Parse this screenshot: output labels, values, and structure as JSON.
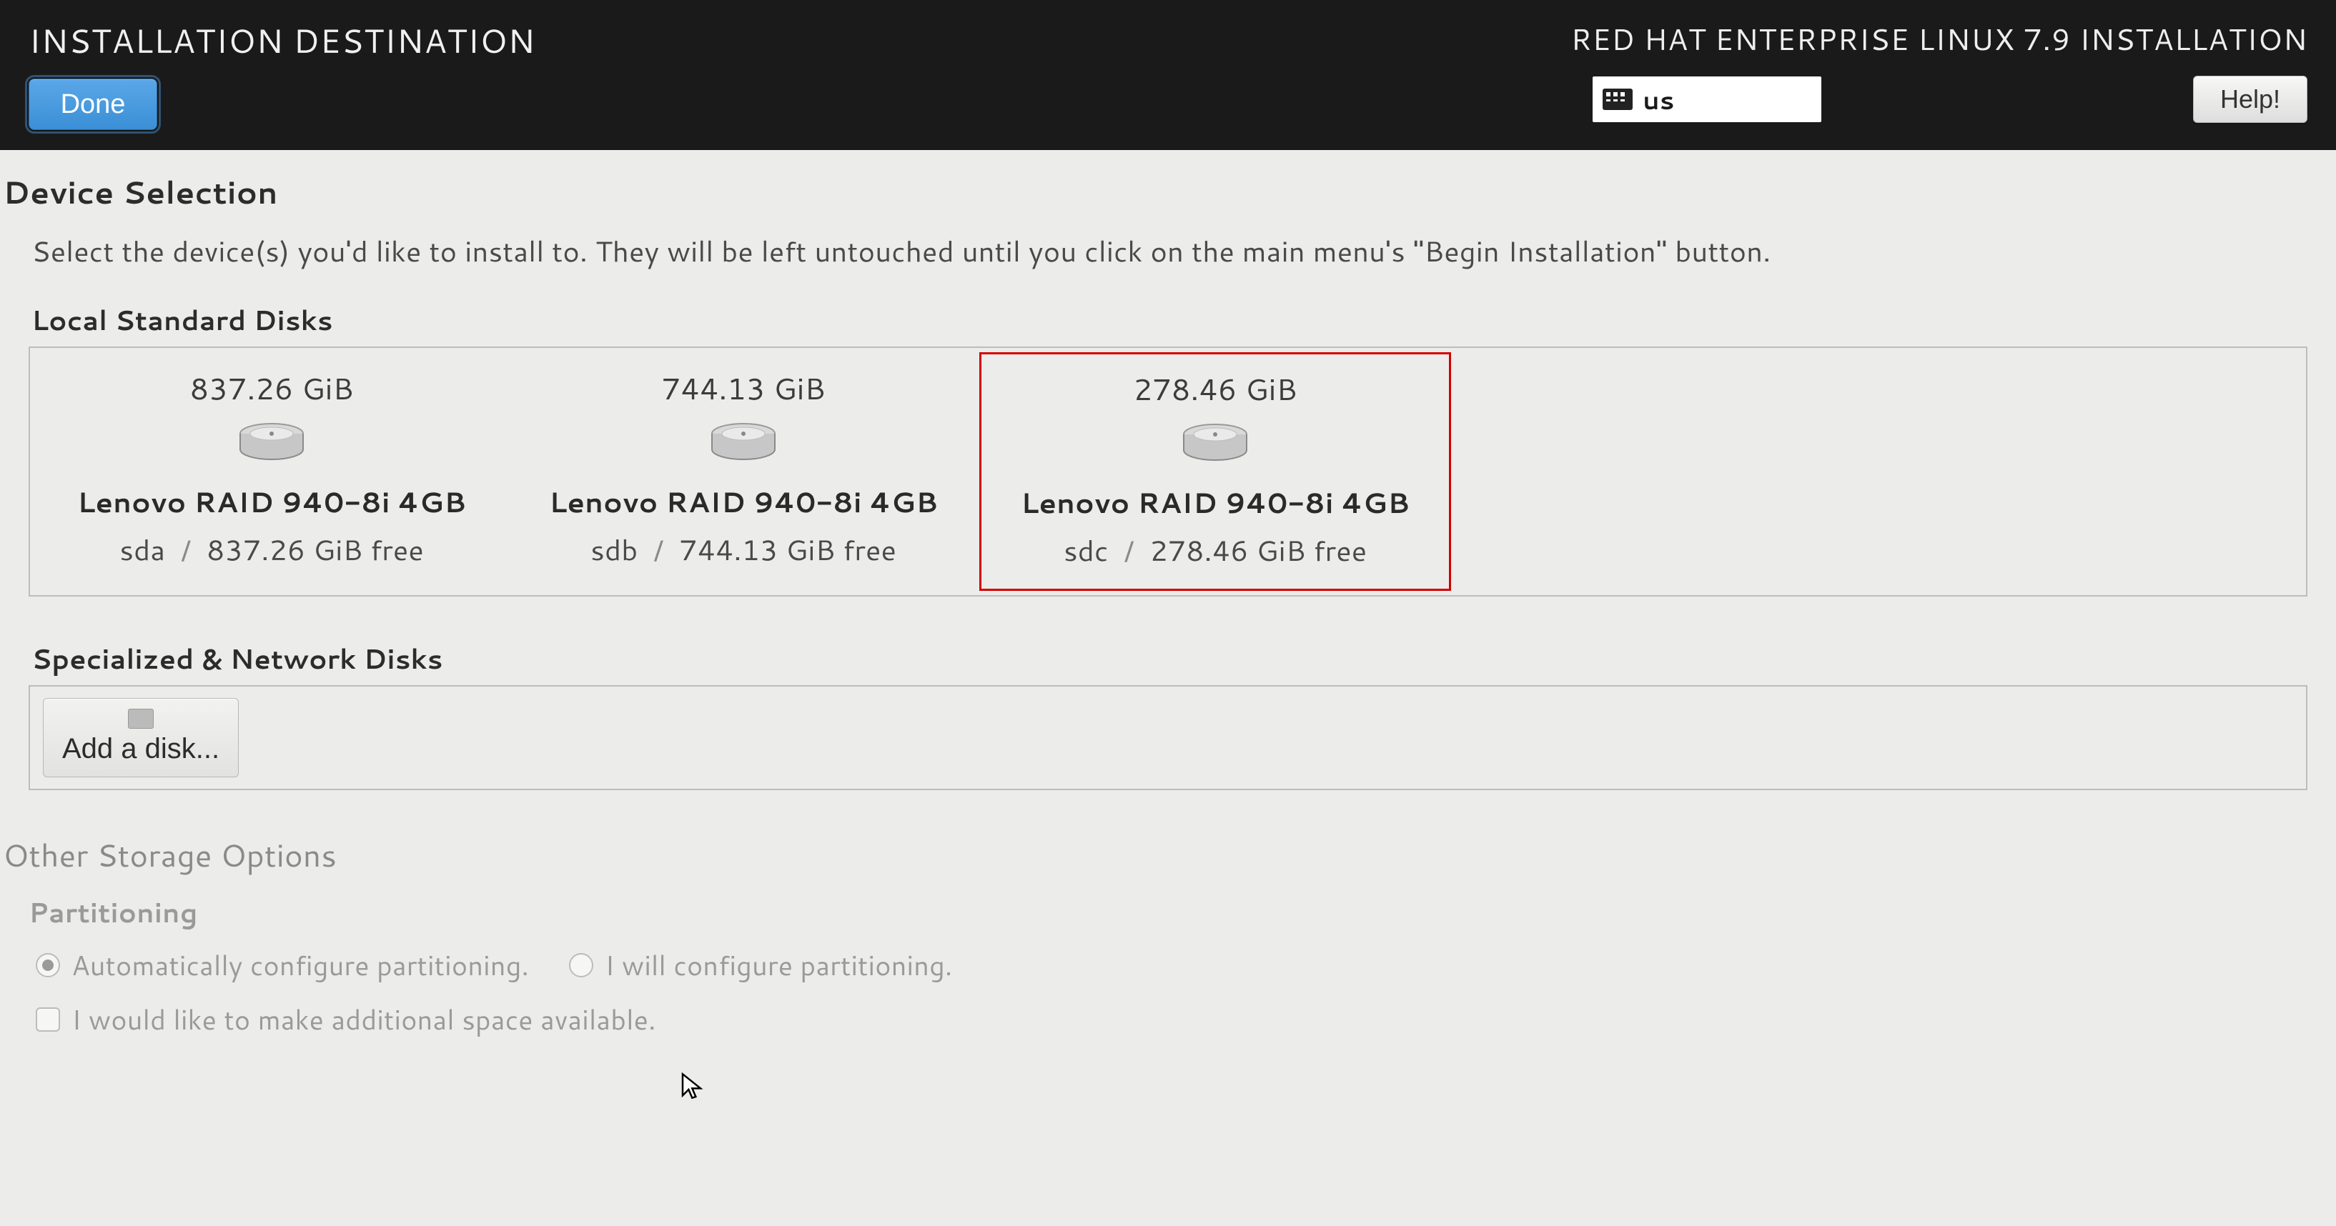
{
  "header": {
    "page_title": "INSTALLATION DESTINATION",
    "done_label": "Done",
    "installer_title": "RED HAT ENTERPRISE LINUX 7.9 INSTALLATION",
    "keyboard_layout": "us",
    "help_label": "Help!"
  },
  "device_selection": {
    "title": "Device Selection",
    "description": "Select the device(s) you'd like to install to.  They will be left untouched until you click on the main menu's \"Begin Installation\" button.",
    "local_label": "Local Standard Disks",
    "disks": [
      {
        "size": "837.26 GiB",
        "name": "Lenovo RAID 940-8i 4GB",
        "dev": "sda",
        "free": "837.26 GiB free",
        "highlighted": false
      },
      {
        "size": "744.13 GiB",
        "name": "Lenovo RAID 940-8i 4GB",
        "dev": "sdb",
        "free": "744.13 GiB free",
        "highlighted": false
      },
      {
        "size": "278.46 GiB",
        "name": "Lenovo RAID 940-8i 4GB",
        "dev": "sdc",
        "free": "278.46 GiB free",
        "highlighted": true
      }
    ],
    "network_label": "Specialized & Network Disks",
    "add_disk_label": "Add a disk..."
  },
  "other_options": {
    "title": "Other Storage Options",
    "partitioning_label": "Partitioning",
    "auto_label": "Automatically configure partitioning.",
    "manual_label": "I will configure partitioning.",
    "free_space_label": "I would like to make additional space available."
  }
}
